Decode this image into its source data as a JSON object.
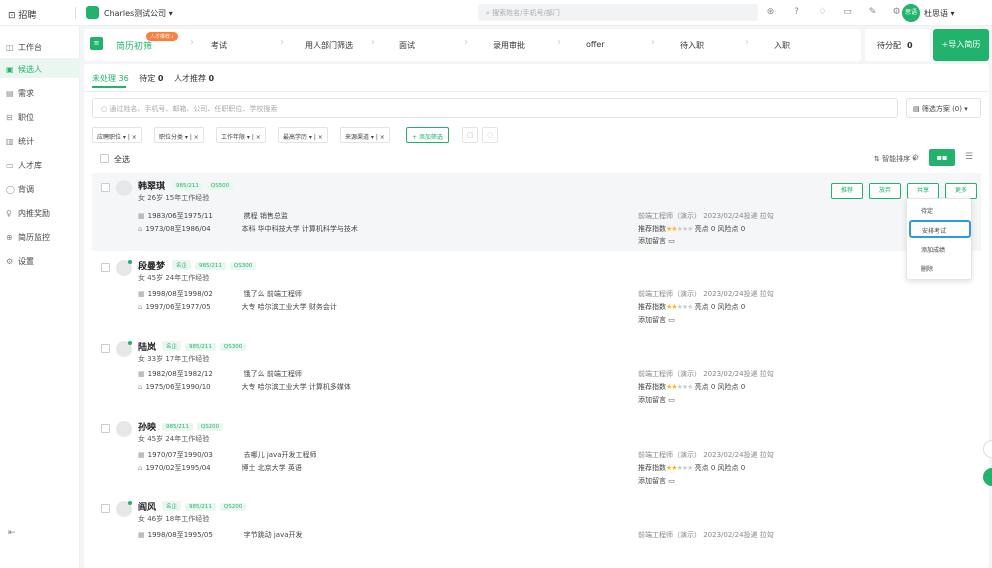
{
  "topbar": {
    "logo": "招聘",
    "company": "Charles测试公司",
    "search_placeholder": "搜索姓名/手机号/部门",
    "avatar_text": "思语",
    "user": "杜思语"
  },
  "sidebar": {
    "items": [
      {
        "label": "工作台",
        "icon": "◫"
      },
      {
        "label": "候选人",
        "icon": "▣"
      },
      {
        "label": "需求",
        "icon": "▤"
      },
      {
        "label": "职位",
        "icon": "⊟"
      },
      {
        "label": "统计",
        "icon": "▥"
      },
      {
        "label": "人才库",
        "icon": "▭"
      },
      {
        "label": "背调",
        "icon": "◯"
      },
      {
        "label": "内推奖励",
        "icon": "♀"
      },
      {
        "label": "简历监控",
        "icon": "⊕"
      },
      {
        "label": "设置",
        "icon": "⚙"
      }
    ],
    "active_index": 1,
    "collapse_icon": "⇤"
  },
  "stages": {
    "badge": "人才推荐↓",
    "items": [
      "简历初筛",
      "考试",
      "用人部门筛选",
      "面试",
      "录用审批",
      "offer",
      "待入职",
      "入职"
    ],
    "current_index": 0
  },
  "pending": {
    "label": "待分配",
    "count": "0"
  },
  "import_button": "+导入简历",
  "tabs": [
    {
      "label": "未处理",
      "count": "36"
    },
    {
      "label": "待定",
      "count": "0"
    },
    {
      "label": "人才推荐",
      "count": "0"
    }
  ],
  "search_placeholder": "通过姓名、手机号、邮箱、公司、任职职位、学校搜索",
  "filter_plan": "筛选方案 (0)",
  "filters": [
    "应聘职位",
    "职位分类",
    "工作年限",
    "最高学历",
    "来源渠道"
  ],
  "add_filter": "+ 添加筛选",
  "select_all": "全选",
  "sort_label": "智能排序",
  "candidates": [
    {
      "name": "韩翠琪",
      "tags": [
        "985/211",
        "QS500"
      ],
      "meta": "女 26岁 15年工作经验",
      "work_period": "1983/06至1975/11",
      "work": "携程 销售总监",
      "edu_period": "1973/08至1986/04",
      "edu": "本科 华中科技大学 计算机科学与技术",
      "apply": "前端工程师（演示） 2023/02/24投递 拉勾",
      "score_label": "推荐指数",
      "highlights": "亮点 0",
      "risks": "风险点 0",
      "comment": "添加留言",
      "stars": 2,
      "new": false
    },
    {
      "name": "段曼梦",
      "tags": [
        "名企",
        "985/211",
        "QS300"
      ],
      "meta": "女 45岁 24年工作经验",
      "work_period": "1998/08至1998/02",
      "work": "饿了么 前端工程师",
      "edu_period": "1997/06至1977/05",
      "edu": "大专 哈尔滨工业大学 财务会计",
      "apply": "前端工程师（演示） 2023/02/24投递 拉勾",
      "score_label": "推荐指数",
      "highlights": "亮点 0",
      "risks": "风险点 0",
      "comment": "添加留言",
      "stars": 2,
      "new": true
    },
    {
      "name": "陆岚",
      "tags": [
        "名企",
        "985/211",
        "QS300"
      ],
      "meta": "女 33岁 17年工作经验",
      "work_period": "1982/08至1982/12",
      "work": "饿了么 前端工程师",
      "edu_period": "1975/06至1990/10",
      "edu": "大专 哈尔滨工业大学 计算机多媒体",
      "apply": "前端工程师（演示） 2023/02/24投递 拉勾",
      "score_label": "推荐指数",
      "highlights": "亮点 0",
      "risks": "风险点 0",
      "comment": "添加留言",
      "stars": 2,
      "new": true
    },
    {
      "name": "孙映",
      "tags": [
        "985/211",
        "QS200"
      ],
      "meta": "女 45岁 24年工作经验",
      "work_period": "1970/07至1990/03",
      "work": "去哪儿 java开发工程师",
      "edu_period": "1970/02至1995/04",
      "edu": "博士 北京大学 英语",
      "apply": "前端工程师（演示） 2023/02/24投递 拉勾",
      "score_label": "推荐指数",
      "highlights": "亮点 0",
      "risks": "风险点 0",
      "comment": "添加留言",
      "stars": 2,
      "new": false
    },
    {
      "name": "阎风",
      "tags": [
        "名企",
        "985/211",
        "QS200"
      ],
      "meta": "女 46岁 18年工作经验",
      "work_period": "1998/08至1995/05",
      "work": "字节跳动 java开发",
      "edu_period": "",
      "edu": "",
      "apply": "前端工程师（演示） 2023/02/24投递 拉勾",
      "score_label": "",
      "highlights": "",
      "risks": "",
      "comment": "",
      "stars": 0,
      "new": true
    }
  ],
  "card_actions": [
    "推荐",
    "放弃",
    "共享",
    "更多"
  ],
  "more_menu": [
    "待定",
    "安排考试",
    "添加成绩",
    "删除"
  ],
  "more_menu_focus_index": 1,
  "colors": {
    "accent": "#21b36b",
    "badge": "#ff7d3b",
    "focus": "#2e9cdb",
    "risk": "#f05050",
    "star": "#f7ba1e"
  }
}
